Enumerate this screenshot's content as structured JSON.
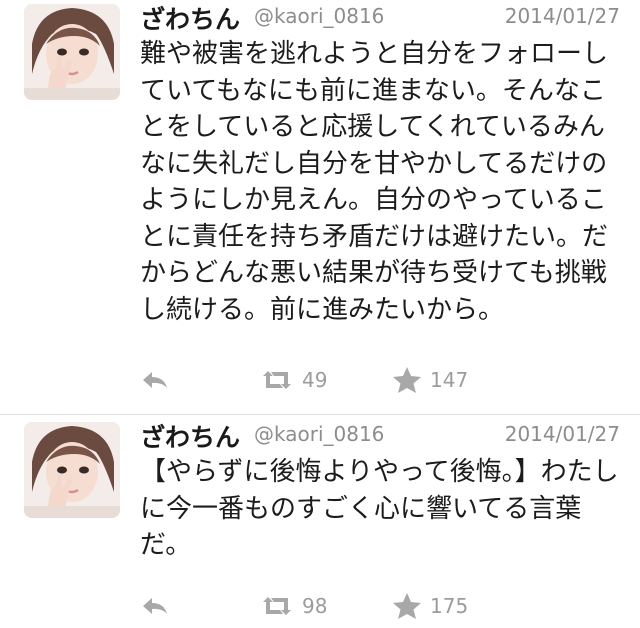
{
  "tweets": [
    {
      "name": "ざわちん",
      "handle": "@kaori_0816",
      "date": "2014/01/27",
      "text": "難や被害を逃れようと自分をフォローしていてもなにも前に進まない。そんなことをしていると応援してくれているみんなに失礼だし自分を甘やかしてるだけのようにしか見えん。自分のやっていることに責任を持ち矛盾だけは避けたい。だからどんな悪い結果が待ち受けても挑戦し続ける。前に進みたいから。",
      "retweets": "49",
      "favorites": "147"
    },
    {
      "name": "ざわちん",
      "handle": "@kaori_0816",
      "date": "2014/01/27",
      "text": "【やらずに後悔よりやって後悔。】わたしに今一番ものすごく心に響いてる言葉だ。",
      "retweets": "98",
      "favorites": "175"
    }
  ],
  "icons": {
    "avatar": "avatar-photo",
    "reply": "reply-arrow-icon",
    "retweet": "retweet-icon",
    "favorite": "star-icon"
  },
  "colors": {
    "text": "#1c1c1c",
    "meta": "#8d8d8d",
    "icon": "#a8a8a8",
    "divider": "#e1e1e1"
  }
}
